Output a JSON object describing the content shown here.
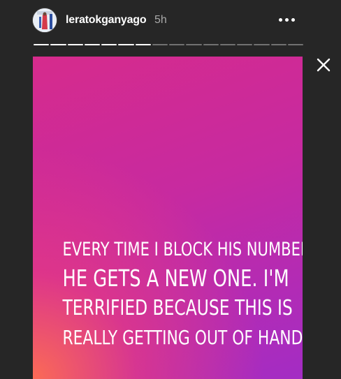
{
  "header": {
    "username": "leratokganyago",
    "time_ago": "5h",
    "avatar_icon": "profile-avatar-icon",
    "more_icon": "more-options-icon"
  },
  "progress": {
    "total_segments": 16,
    "completed_segments": 7
  },
  "close_icon": "close-icon",
  "story": {
    "background_colors": [
      "#d62b8c",
      "#a32cc4",
      "#ff6e50"
    ],
    "lines": [
      "EVERY TIME I BLOCK HIS NUMBER",
      "HE GETS A NEW ONE. I'M",
      "TERRIFIED BECAUSE THIS IS",
      "REALLY GETTING OUT OF HAND!"
    ]
  }
}
